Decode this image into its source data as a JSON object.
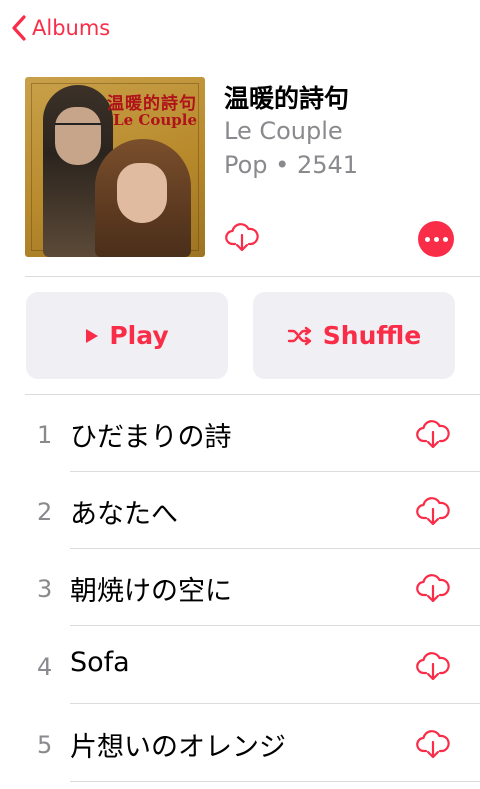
{
  "nav": {
    "back_label": "Albums"
  },
  "album": {
    "title": "温暖的詩句",
    "artist": "Le Couple",
    "genre_year": "Pop • 2541",
    "cover_text_cn": "温暖的詩句",
    "cover_text_en": "Le Couple"
  },
  "actions": {
    "play_label": "Play",
    "shuffle_label": "Shuffle"
  },
  "tracks": [
    {
      "number": "1",
      "title": "ひだまりの詩"
    },
    {
      "number": "2",
      "title": "あなたへ"
    },
    {
      "number": "3",
      "title": "朝焼けの空に"
    },
    {
      "number": "4",
      "title": "Sofa"
    },
    {
      "number": "5",
      "title": "片想いのオレンジ"
    }
  ],
  "colors": {
    "accent": "#fa2d48",
    "secondary_text": "#8a8a8e",
    "button_bg": "#f0f0f4",
    "separator": "#dcdce0"
  },
  "icons": {
    "back": "chevron-left-icon",
    "download": "cloud-download-icon",
    "more": "ellipsis-icon",
    "play": "play-icon",
    "shuffle": "shuffle-icon"
  }
}
